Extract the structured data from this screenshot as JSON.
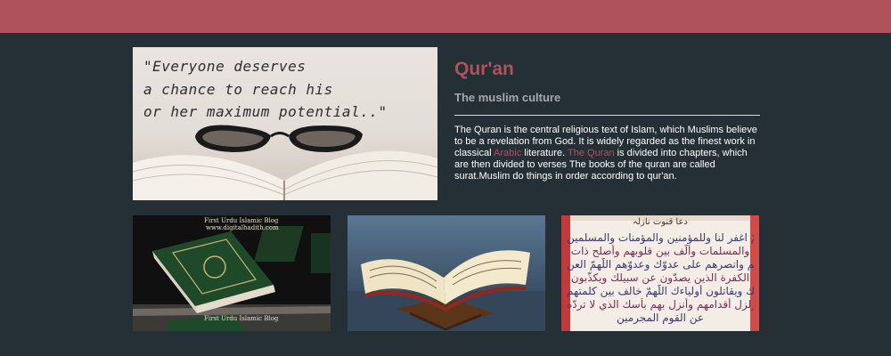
{
  "header": {
    "color": "#b0525c"
  },
  "hero": {
    "quote_lines": [
      "\"Everyone deserves",
      "a chance to reach his",
      "or her maximum potential..\""
    ]
  },
  "article": {
    "title": "Qur'an",
    "subtitle": "The muslim culture",
    "text_1": "The Quran is the central religious text of Islam, which Muslims believe to be a revelation from God. It is widely regarded as the finest work in classical ",
    "link_arabic": "Arabic",
    "text_2": " literature. ",
    "link_quran": "The Quran",
    "text_3": " is divided into chapters, which are then divided to verses The books of the quran are called surat.Muslim do things in order according to qur'an.",
    "accent_color": "#b0525c"
  },
  "thumbnails": [
    {
      "icon": "quran-books-image",
      "caption_top": "First Urdu Islamic Blog",
      "caption_sub": "www.digitalhadith.com",
      "caption_bottom": "First Urdu Islamic Blog"
    },
    {
      "icon": "open-quran-on-stand-image"
    },
    {
      "icon": "dua-qunoot-arabic-image",
      "heading": "دعا قنوت نازلہ",
      "lines": [
        "اللّٰهمّ اغفر لنا وللمؤمنين والمؤمنات والمسلمين",
        "والمسلمات وألّف بين قلوبهم وأصلح ذات",
        "بينهم وانصرهم على عدوّك وعدوّهم اللّٰهمّ العن",
        "الكفرة الذين يصدّون عن سبيلك ويكذّبون",
        "رسلك ويقاتلون أولياءك اللّٰهمّ خالف بين كلمتهم",
        "وزلزل أقدامهم وأنزل بهم بأسك الذي لا تردّه",
        "عن القوم المجرمين"
      ]
    }
  ]
}
